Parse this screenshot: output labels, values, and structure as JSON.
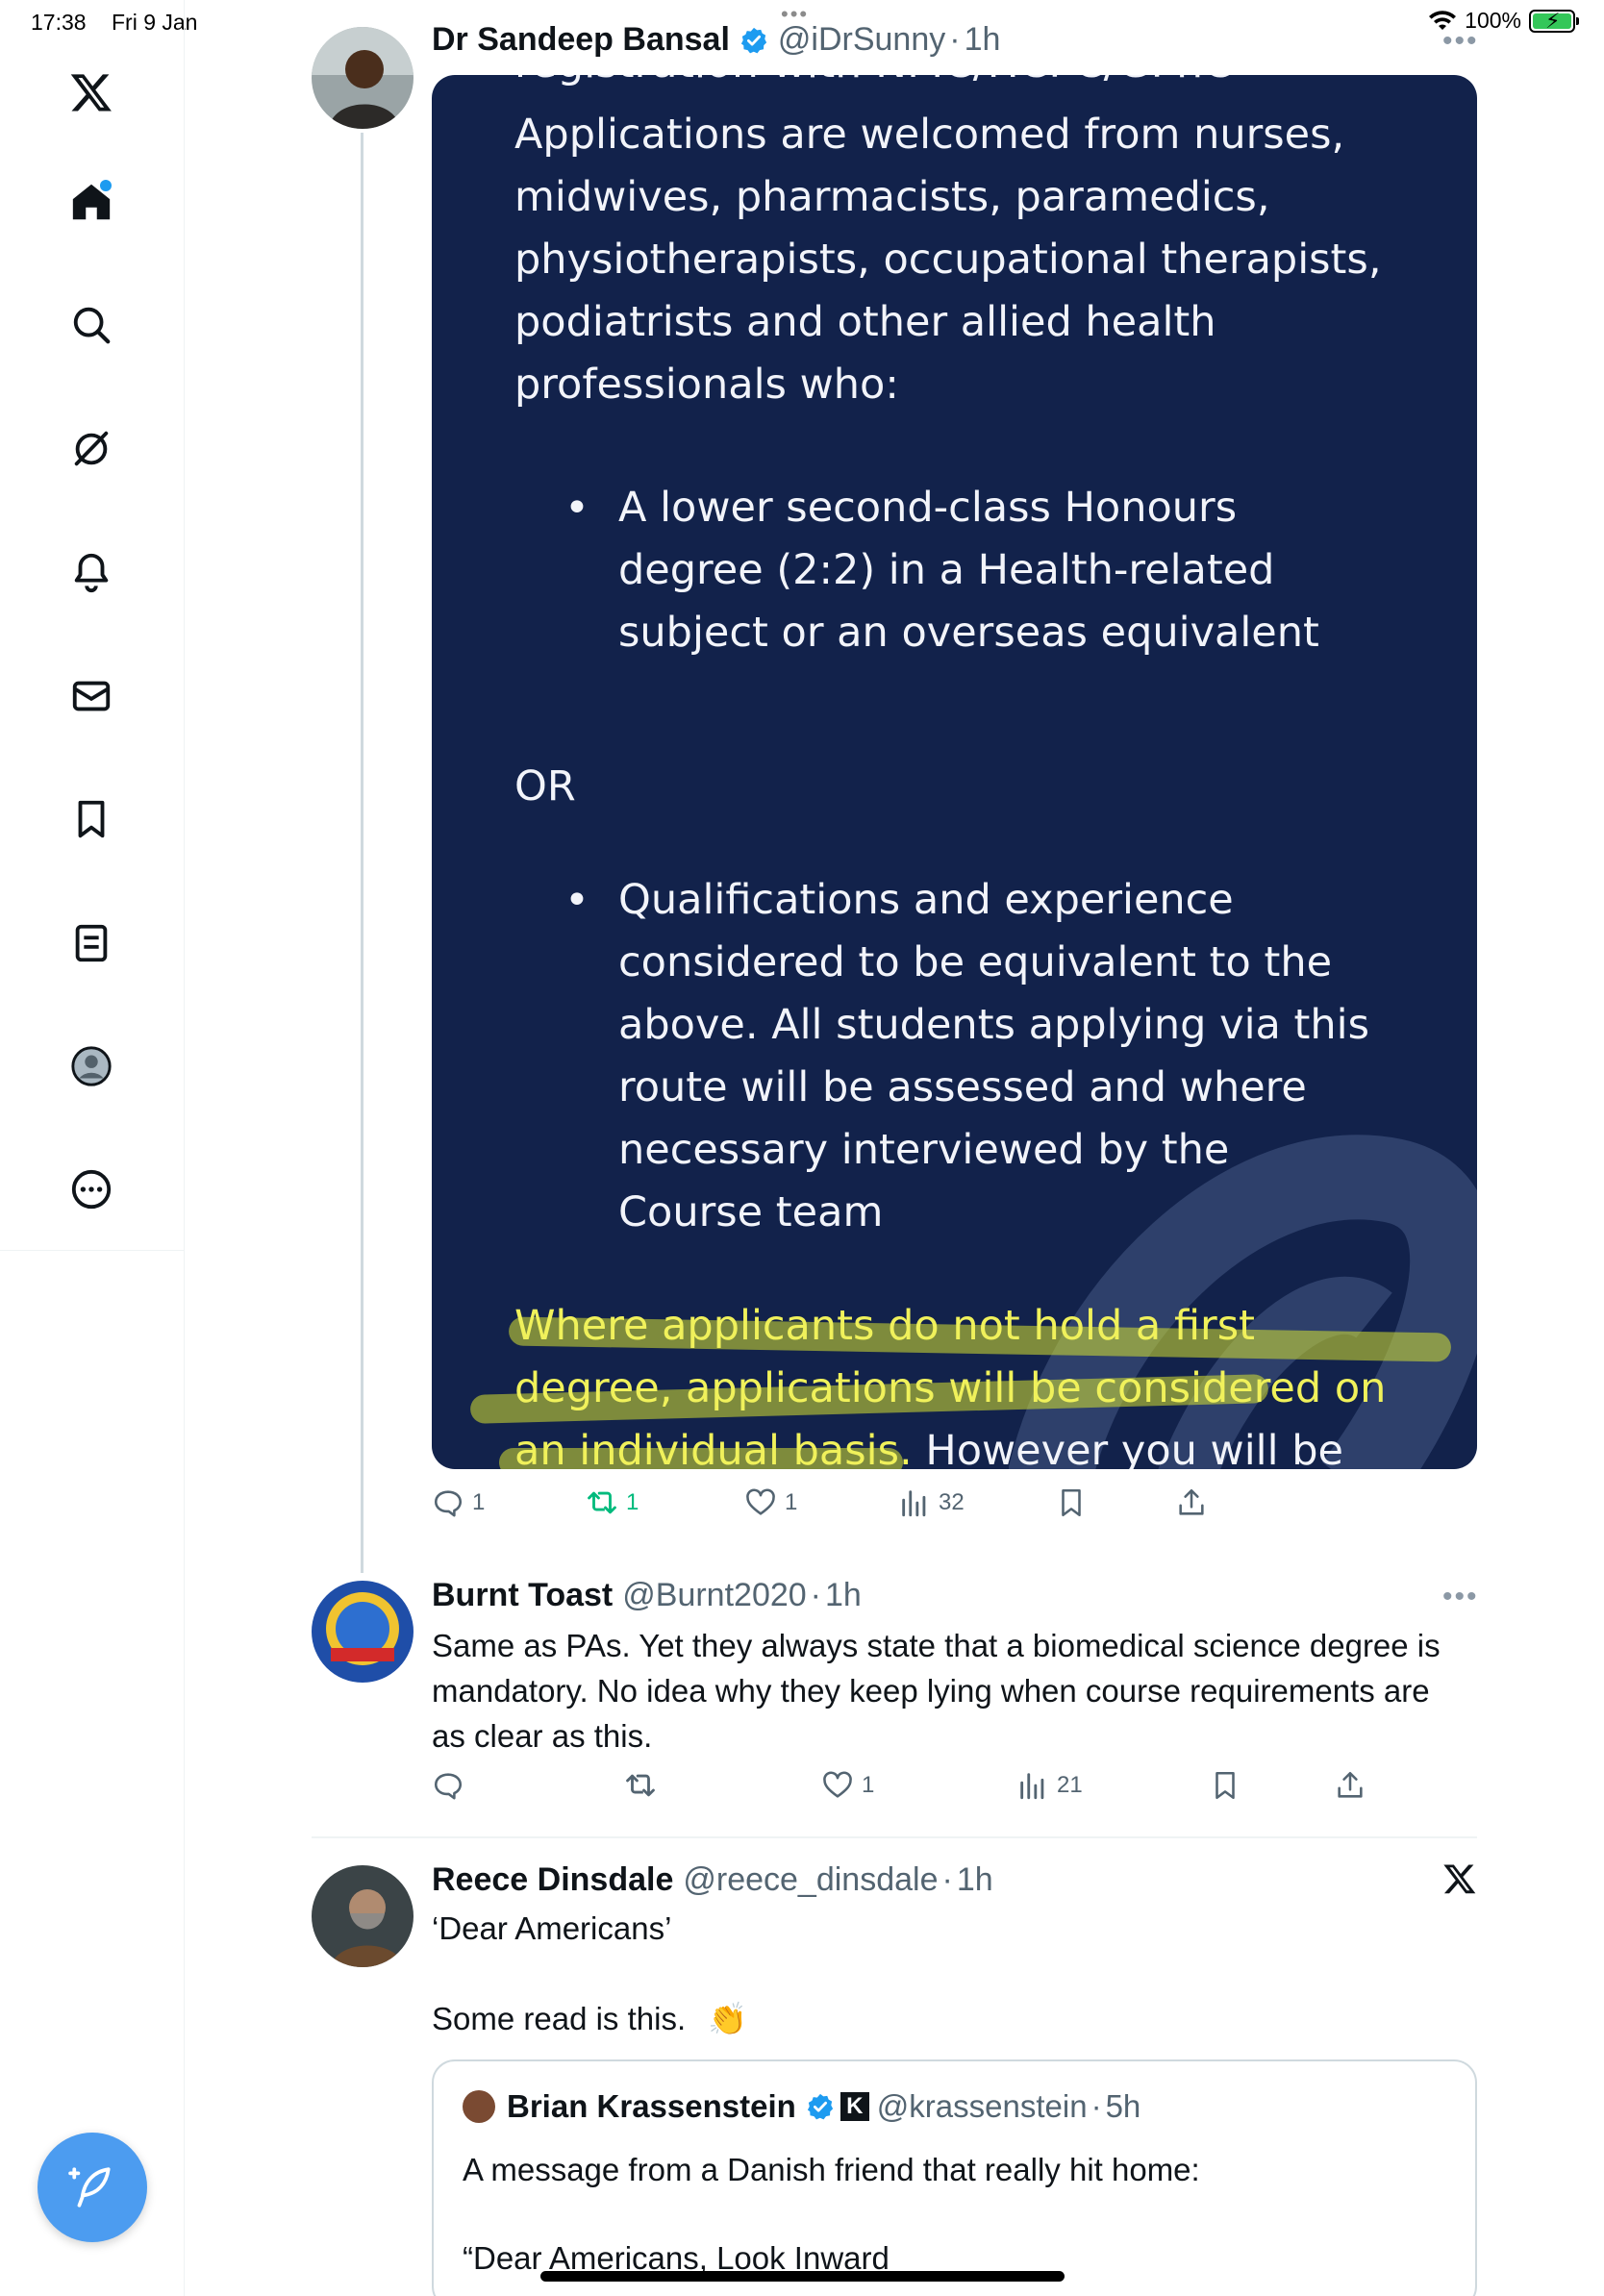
{
  "status_bar": {
    "time": "17:38",
    "date": "Fri 9 Jan",
    "battery": "100%",
    "battery_level": 1.0
  },
  "sidebar": {
    "items": [
      {
        "icon": "x-logo-icon"
      },
      {
        "icon": "home-icon",
        "has_notification_dot": true
      },
      {
        "icon": "search-icon"
      },
      {
        "icon": "grok-icon"
      },
      {
        "icon": "bell-icon"
      },
      {
        "icon": "mail-icon"
      },
      {
        "icon": "bookmark-icon"
      },
      {
        "icon": "lists-icon"
      },
      {
        "icon": "profile-icon"
      },
      {
        "icon": "more-icon"
      }
    ],
    "compose_icon": "compose-icon"
  },
  "colors": {
    "accent": "#1d9bf0",
    "media_bg": "#12224b",
    "highlight": "#f0f15b",
    "retweeted": "#00ba7c"
  },
  "tweet1": {
    "name": "Dr Sandeep Bansal",
    "handle": "@iDrSunny",
    "time": "1h",
    "media_text": {
      "top_cut": "registration with NMC/HCPC/GPhC",
      "intro": "Applications are welcomed from nurses, midwives, pharmacists, paramedics, physiotherapists, occupational therapists, podiatrists and other allied health professionals who:",
      "bullet1": "A lower second-class Honours degree (2:2) in a Health-related subject or an overseas equivalent",
      "or": "OR",
      "bullet2": "Qualifications and experience considered to be equivalent to the above. All students applying via this route will be assessed and where necessary interviewed by the Course team",
      "highlight": "Where applicants do not hold a first degree, applications will be considered on an individual basis.",
      "tail": " However you will be"
    },
    "actions": {
      "replies": "1",
      "reposts": "1",
      "likes": "1",
      "views": "32"
    }
  },
  "tweet2": {
    "name": "Burnt Toast",
    "handle": "@Burnt2020",
    "time": "1h",
    "text": "Same as PAs. Yet they always state that a biomedical science degree is mandatory. No idea why they keep lying when course requirements are as clear as this.",
    "actions": {
      "replies": "",
      "reposts": "",
      "likes": "1",
      "views": "21"
    }
  },
  "tweet3": {
    "name": "Reece Dinsdale",
    "handle": "@reece_dinsdale",
    "time": "1h",
    "line1": "‘Dear Americans’",
    "line2": "Some read is this.",
    "emoji": "👏",
    "quote": {
      "name": "Brian Krassenstein",
      "handle": "@krassenstein",
      "time": "5h",
      "line1": "A message from a Danish friend that really hit home:",
      "line2": "“Dear Americans, Look Inward"
    }
  }
}
